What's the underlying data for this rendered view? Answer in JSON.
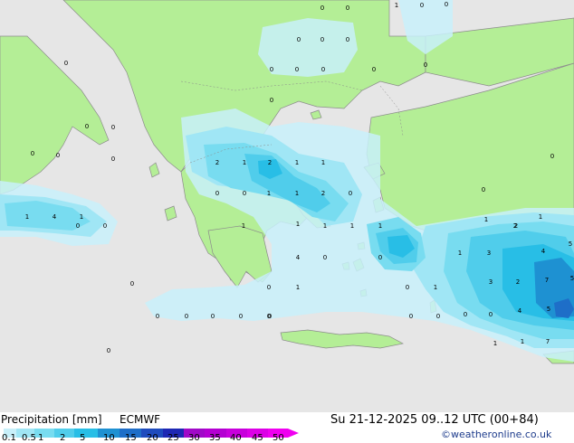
{
  "title": "Precipitation [mm]",
  "model": "ECMWF",
  "valid_time": "Su 21-12-2025 09..12 UTC (00+84)",
  "credit": "©weatheronline.co.uk",
  "legend": {
    "ticks": [
      "0.1",
      "0.5",
      "1",
      "2",
      "5",
      "10",
      "15",
      "20",
      "25",
      "30",
      "35",
      "40",
      "45",
      "50"
    ],
    "colors": [
      "#c8f0fa",
      "#a0e6f5",
      "#78dcf0",
      "#50cdeb",
      "#28bee6",
      "#1e91d2",
      "#1e6ec8",
      "#1e4bbe",
      "#1e28b4",
      "#a00ac8",
      "#b400d2",
      "#c800dc",
      "#dc00e6",
      "#f000f0"
    ]
  },
  "colors": {
    "sea": "#e6e6e6",
    "land": "#b4ee96",
    "coast": "#8c8c8c"
  },
  "map_labels": [
    {
      "text": "0"
    },
    {
      "text": "0"
    },
    {
      "text": "1"
    },
    {
      "text": "0"
    },
    {
      "text": "0"
    },
    {
      "text": "0"
    },
    {
      "text": "0"
    },
    {
      "text": "0"
    },
    {
      "text": "0"
    },
    {
      "text": "0"
    },
    {
      "text": "0"
    },
    {
      "text": "0"
    },
    {
      "text": "0"
    },
    {
      "text": "0"
    },
    {
      "text": "0"
    },
    {
      "text": "0"
    },
    {
      "text": "0"
    },
    {
      "text": "0"
    },
    {
      "text": "0"
    },
    {
      "text": "0"
    },
    {
      "text": "2"
    },
    {
      "text": "1"
    },
    {
      "text": "2"
    },
    {
      "text": "1"
    },
    {
      "text": "1"
    },
    {
      "text": "0"
    },
    {
      "text": "0"
    },
    {
      "text": "1"
    },
    {
      "text": "1"
    },
    {
      "text": "2"
    },
    {
      "text": "0"
    },
    {
      "text": "1"
    },
    {
      "text": "4"
    },
    {
      "text": "1"
    },
    {
      "text": "0"
    },
    {
      "text": "0"
    },
    {
      "text": "1"
    },
    {
      "text": "1"
    },
    {
      "text": "1"
    },
    {
      "text": "1"
    },
    {
      "text": "4"
    },
    {
      "text": "0"
    },
    {
      "text": "0"
    },
    {
      "text": "2"
    },
    {
      "text": "1"
    },
    {
      "text": "1"
    },
    {
      "text": "0"
    },
    {
      "text": "1"
    },
    {
      "text": "3"
    },
    {
      "text": "2"
    },
    {
      "text": "4"
    },
    {
      "text": "5"
    },
    {
      "text": "0"
    },
    {
      "text": "0"
    },
    {
      "text": "0"
    },
    {
      "text": "0"
    },
    {
      "text": "0"
    },
    {
      "text": "0"
    },
    {
      "text": "0"
    },
    {
      "text": "0"
    },
    {
      "text": "1"
    },
    {
      "text": "0"
    },
    {
      "text": "3"
    },
    {
      "text": "2"
    },
    {
      "text": "7"
    },
    {
      "text": "5"
    },
    {
      "text": "0"
    },
    {
      "text": "0"
    },
    {
      "text": "4"
    },
    {
      "text": "5"
    },
    {
      "text": "7"
    },
    {
      "text": "1"
    },
    {
      "text": "1"
    },
    {
      "text": "0"
    },
    {
      "text": "0"
    },
    {
      "text": "1"
    },
    {
      "text": "1"
    },
    {
      "text": "0"
    },
    {
      "text": "0"
    }
  ]
}
